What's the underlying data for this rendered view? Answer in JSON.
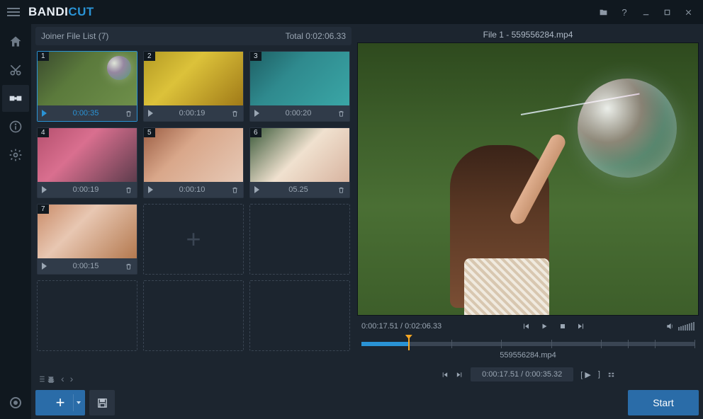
{
  "app": {
    "logo_part1": "BANDI",
    "logo_part2": "CUT"
  },
  "titlebar": {
    "icons": [
      "folder-icon",
      "help-icon",
      "minimize-icon",
      "maximize-icon",
      "close-icon"
    ]
  },
  "sidenav": {
    "items": [
      {
        "name": "home-icon"
      },
      {
        "name": "cut-icon"
      },
      {
        "name": "join-icon",
        "active": true
      },
      {
        "name": "info-icon"
      },
      {
        "name": "settings-icon"
      }
    ]
  },
  "leftpanel": {
    "header_label": "Joiner File List (7)",
    "header_total": "Total 0:02:06.33",
    "clips": [
      {
        "index": "1",
        "time": "0:00:35",
        "selected": true,
        "imgclass": "bubbles"
      },
      {
        "index": "2",
        "time": "0:00:19",
        "imgclass": "yellow"
      },
      {
        "index": "3",
        "time": "0:00:20",
        "imgclass": "water"
      },
      {
        "index": "4",
        "time": "0:00:19",
        "imgclass": "pink"
      },
      {
        "index": "5",
        "time": "0:00:10",
        "imgclass": "sun"
      },
      {
        "index": "6",
        "time": "05.25",
        "imgclass": "bunny"
      },
      {
        "index": "7",
        "time": "0:00:15",
        "imgclass": "camera"
      }
    ]
  },
  "preview": {
    "title": "File 1 - 559556284.mp4",
    "time_current": "0:00:17.51",
    "time_total": "0:02:06.33",
    "time_display": "0:00:17.51 / 0:02:06.33",
    "clip_name": "559556284.mp4",
    "range_display": "0:00:17.51 / 0:00:35.32"
  },
  "buttons": {
    "start": "Start"
  },
  "colors": {
    "accent": "#2a93d5",
    "primary_btn": "#2a6ca8",
    "bg_dark": "#10181f",
    "bg": "#1c252f"
  }
}
